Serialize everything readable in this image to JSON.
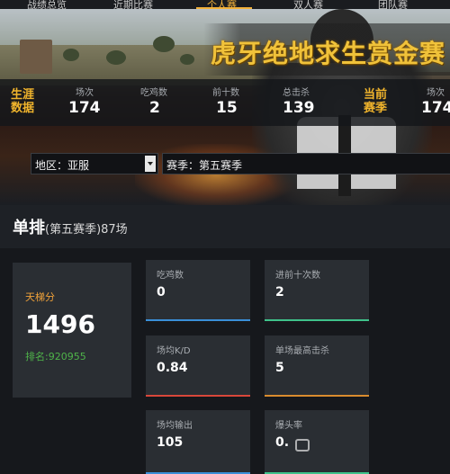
{
  "nav": {
    "tabs": [
      "战绩总览",
      "近期比赛",
      "个人赛",
      "双人赛",
      "团队赛"
    ],
    "active_color": "#f3b23a"
  },
  "hero": {
    "banner": "虎牙绝地求生赏金赛"
  },
  "career": {
    "label_line1": "生涯",
    "label_line2": "数据",
    "items": [
      {
        "label": "场次",
        "value": "174"
      },
      {
        "label": "吃鸡数",
        "value": "2"
      },
      {
        "label": "前十数",
        "value": "15"
      },
      {
        "label": "总击杀",
        "value": "139"
      }
    ]
  },
  "season": {
    "label_line1": "当前",
    "label_line2": "赛季",
    "items": [
      {
        "label": "场次",
        "value": "174"
      }
    ]
  },
  "filters": {
    "region": "地区：亚服",
    "season": "赛季：第五赛季"
  },
  "section": {
    "title": "单排",
    "subtitle": "(第五赛季)87场"
  },
  "ladder": {
    "label": "天梯分",
    "score": "1496",
    "rank": "排名:920955"
  },
  "cards": [
    {
      "label": "吃鸡数",
      "value": "0",
      "color": "#3a8fd8"
    },
    {
      "label": "进前十次数",
      "value": "2",
      "color": "#3fc28b"
    },
    {
      "label": "场均K/D",
      "value": "0.84",
      "color": "#d8473a"
    },
    {
      "label": "单场最高击杀",
      "value": "5",
      "color": "#d98c2e"
    },
    {
      "label": "场均输出",
      "value": "105",
      "color": "#3a8fd8"
    },
    {
      "label": "爆头率",
      "value": "0.",
      "color": "#3fc28b"
    }
  ]
}
